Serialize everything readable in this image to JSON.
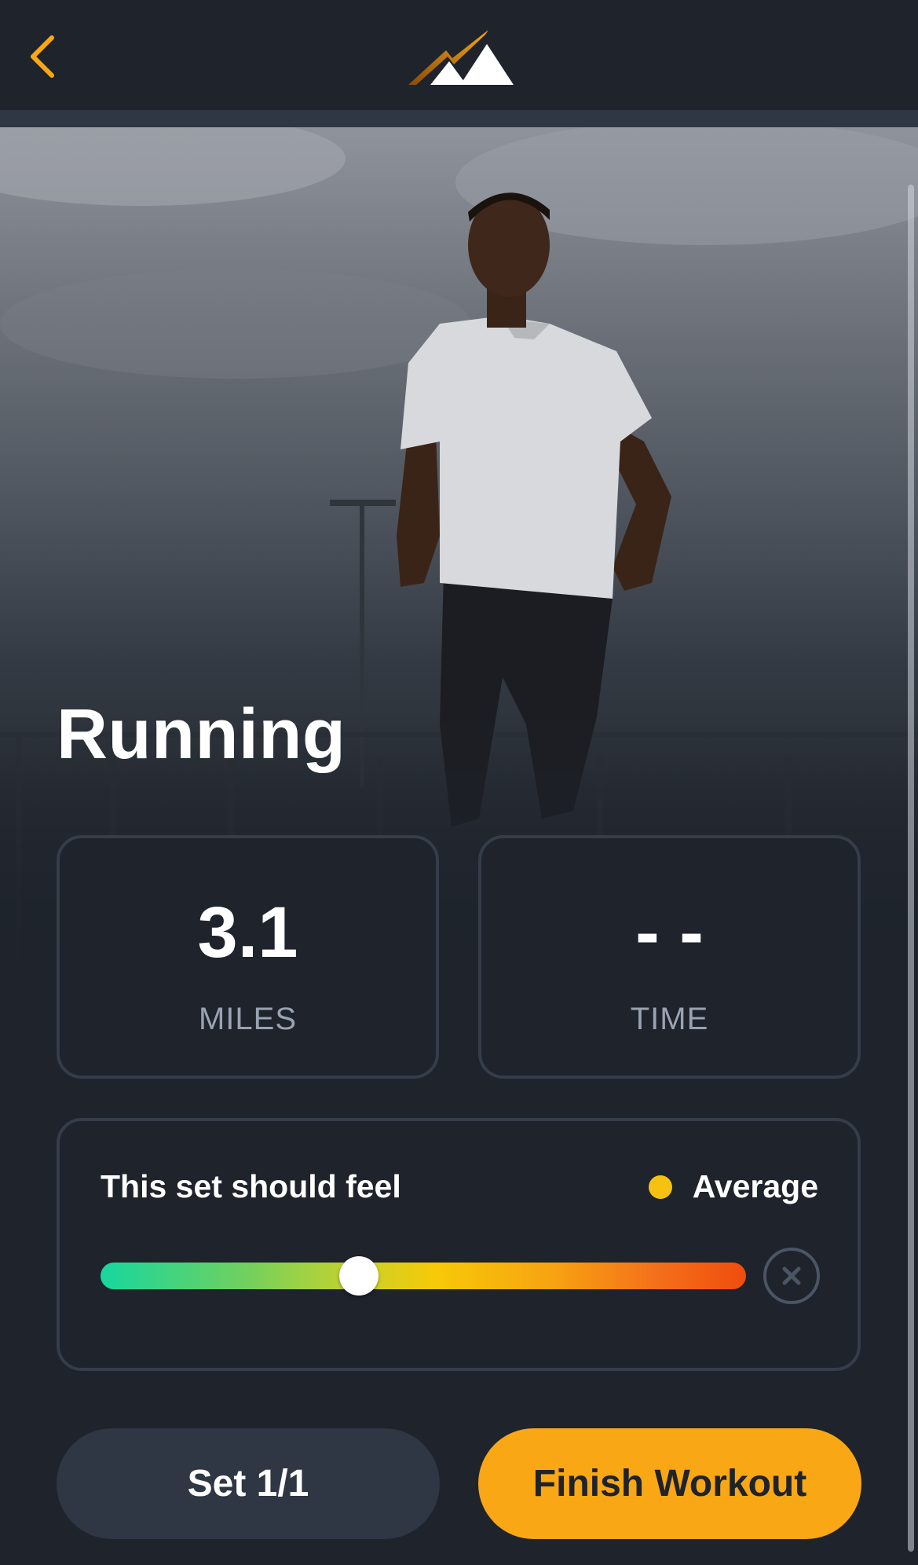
{
  "header": {
    "back_icon": "chevron-left-icon",
    "logo_icon": "mountain-logo-icon"
  },
  "workout": {
    "title": "Running"
  },
  "stats": [
    {
      "value": "3.1",
      "label": "MILES"
    },
    {
      "value": "- -",
      "label": "TIME"
    }
  ],
  "feel": {
    "label": "This set should feel",
    "level": "Average",
    "slider_value": 0.4,
    "clear_icon": "close-circle-icon"
  },
  "actions": {
    "set_label": "Set 1/1",
    "finish_label": "Finish Workout"
  },
  "colors": {
    "accent": "#f9a714",
    "background": "#1e232c",
    "card_border": "#353d4a",
    "dot": "#f7c20f"
  }
}
